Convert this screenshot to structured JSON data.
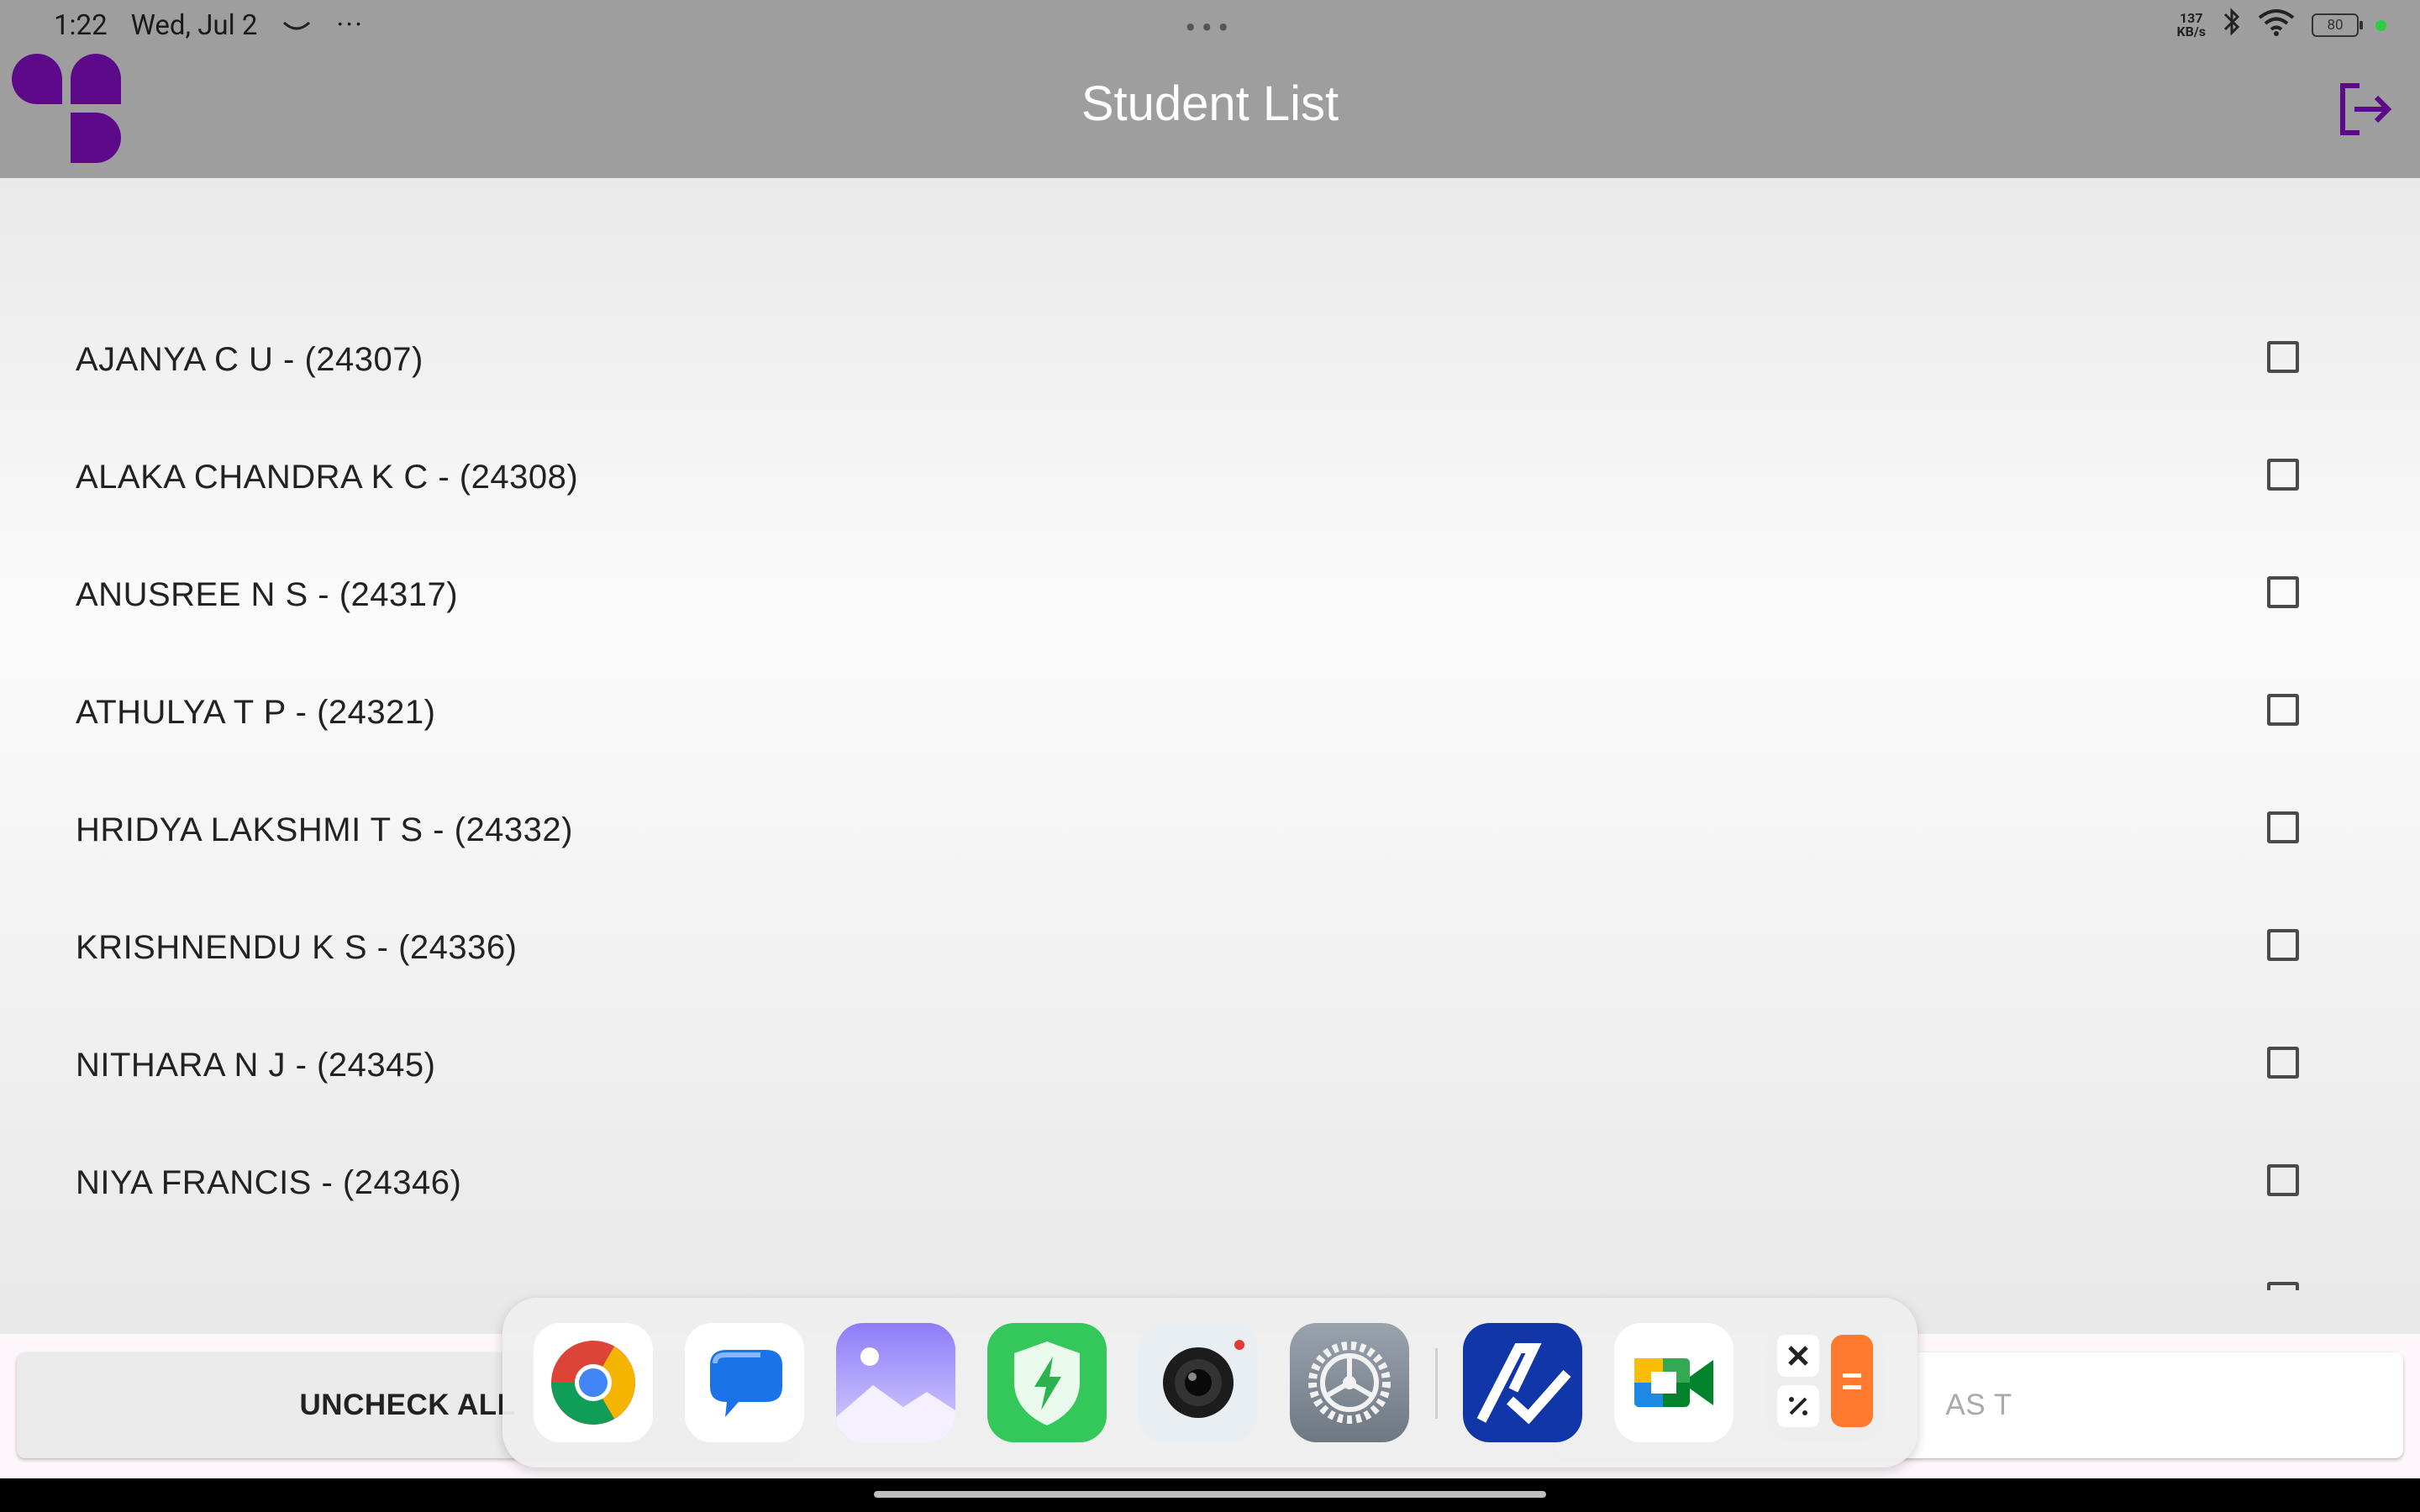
{
  "status_bar": {
    "time": "1:22",
    "date": "Wed, Jul 2",
    "center_dots": "•••",
    "network_speed_value": "137",
    "network_speed_unit": "KB/s",
    "battery_level": "80"
  },
  "header": {
    "title": "Student List"
  },
  "students": [
    {
      "label": "AJANYA C U - (24307)",
      "checked": false
    },
    {
      "label": "ALAKA CHANDRA K C - (24308)",
      "checked": false
    },
    {
      "label": "ANUSREE N S - (24317)",
      "checked": false
    },
    {
      "label": "ATHULYA T P - (24321)",
      "checked": false
    },
    {
      "label": "HRIDYA LAKSHMI T S - (24332)",
      "checked": false
    },
    {
      "label": "KRISHNENDU K S - (24336)",
      "checked": false
    },
    {
      "label": "NITHARA N J - (24345)",
      "checked": false
    },
    {
      "label": "NIYA FRANCIS - (24346)",
      "checked": false
    }
  ],
  "actions": {
    "uncheck_all_label": "UNCHECK ALL",
    "right_button_visible_text": "AS T"
  },
  "dock": {
    "apps": [
      "Chrome",
      "Messages",
      "Gallery",
      "Security",
      "Camera",
      "Settings",
      "Attendance",
      "Meet",
      "Calculator"
    ]
  },
  "colors": {
    "brand_purple": "#5c0a8a",
    "header_gray": "#9e9e9e"
  }
}
